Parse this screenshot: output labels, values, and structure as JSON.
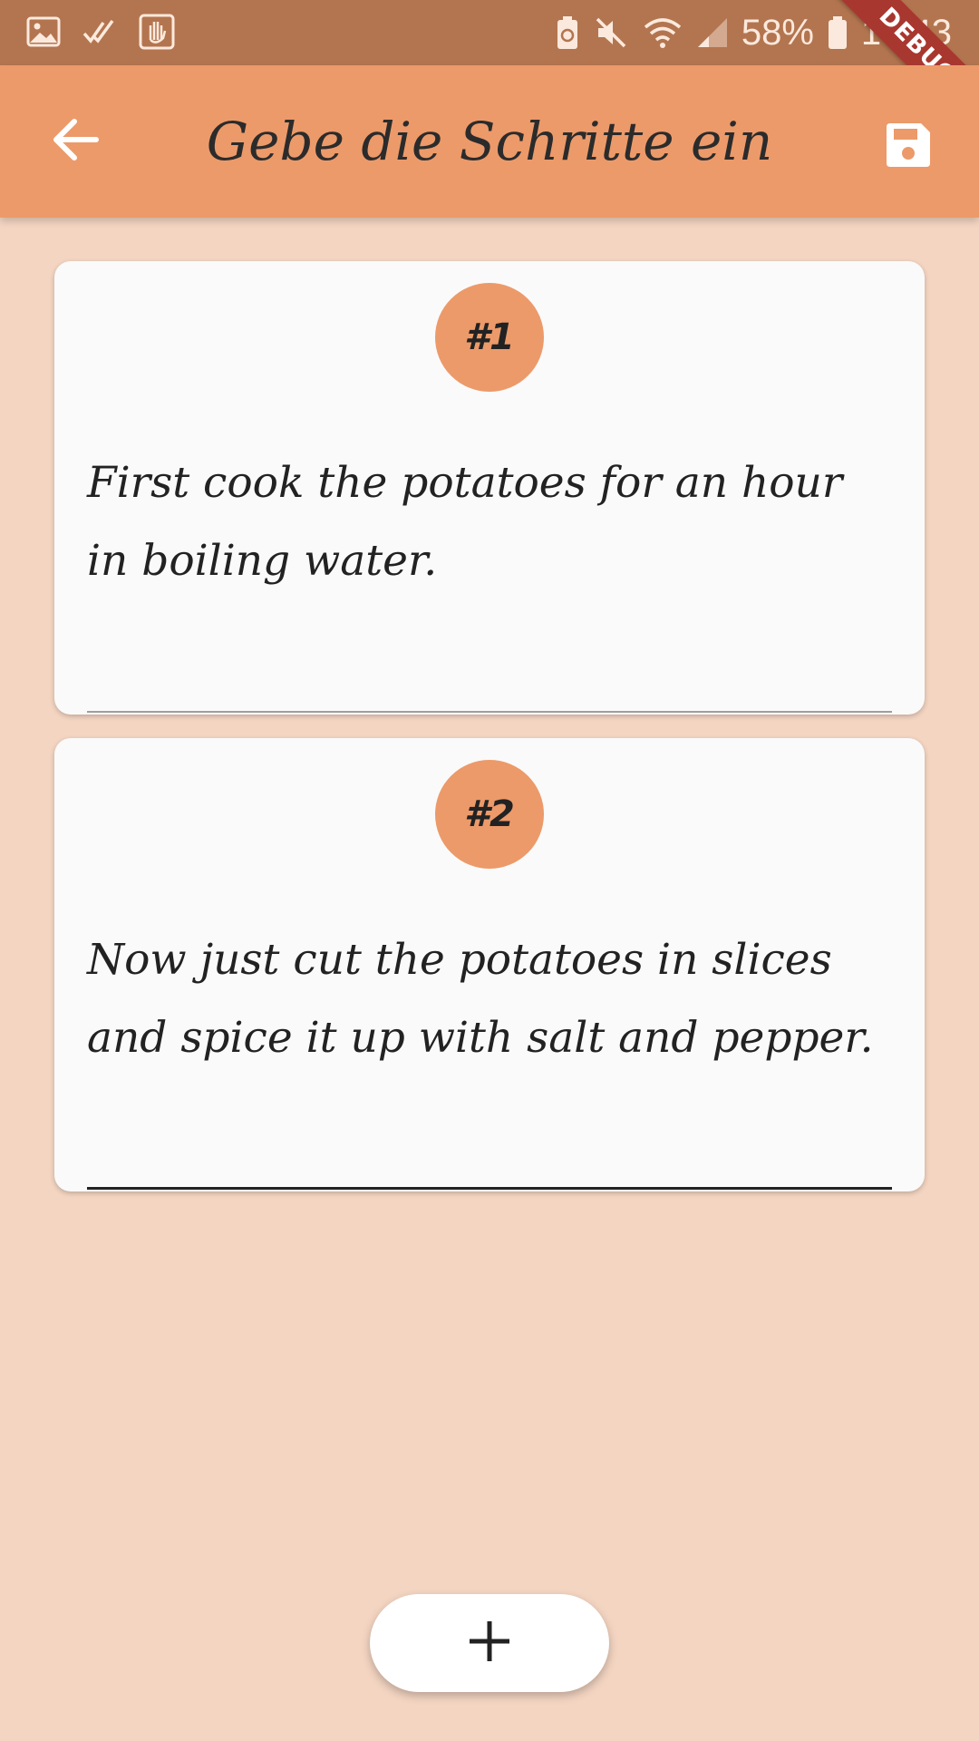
{
  "status_bar": {
    "battery_percent": "58%",
    "time": "10:43",
    "left_icons": [
      "gallery-icon",
      "double-check-icon",
      "hand-icon"
    ],
    "right_icons": [
      "battery-saver-icon",
      "mute-icon",
      "wifi-icon",
      "signal-icon",
      "battery-icon"
    ]
  },
  "debug_banner": "DEBUG",
  "app_bar": {
    "title": "Gebe die Schritte ein",
    "back_icon": "arrow-back-icon",
    "save_icon": "save-icon"
  },
  "steps": [
    {
      "number": "#1",
      "text": "First cook the potatoes for an hour in boiling water."
    },
    {
      "number": "#2",
      "text": "Now just cut the potatoes in slices and spice it up with salt and pepper."
    }
  ],
  "add_button": {
    "icon": "plus-icon"
  },
  "colors": {
    "status_bar": "#b3754f",
    "app_bar": "#ec9a6a",
    "background": "#f4d5c2",
    "card": "#fafafa",
    "badge": "#ec9a6a",
    "debug_ribbon": "#a8372f"
  }
}
